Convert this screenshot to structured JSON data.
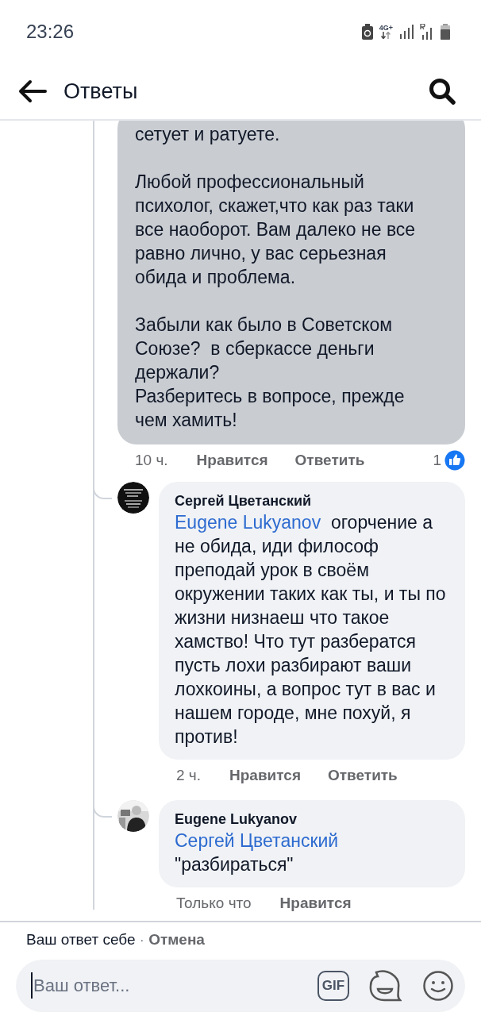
{
  "status_bar": {
    "time": "23:26",
    "network": "4G+"
  },
  "header": {
    "title": "Ответы"
  },
  "comment": {
    "selected": true,
    "paragraphs": [
      [
        "сетует и ратуете."
      ],
      [
        "Любой профессиональный психолог, скажет,что как раз таки все наоборот. Вам далеко не все равно лично, у вас серьезная обида и проблема."
      ],
      [
        "Забыли как было в Советском Союзе?  в сберкассе деньги держали?",
        "Разберитесь в вопросе, прежде чем хамить!"
      ]
    ],
    "time": "10 ч.",
    "actions": [
      "Нравится",
      "Ответить"
    ],
    "like_count": "1"
  },
  "replies": [
    {
      "author": "Сергей Цветанский",
      "mention": "Eugene Lukyanov",
      "text": "огорчение а не обида, иди философ преподай урок в своём окружении таких как ты, и ты по жизни низнаеш что такое хамство! Что тут разбератся пусть лохи разбирают ваши лохкоины, а вопрос тут в вас и нашем городе, мне похуй, я против!",
      "time": "2 ч.",
      "actions": [
        "Нравится",
        "Ответить"
      ]
    },
    {
      "author": "Eugene Lukyanov",
      "mention": "Сергей Цветанский",
      "text": "\"разбираться\"",
      "time": "Только что",
      "actions": [
        "Нравится"
      ]
    }
  ],
  "composer": {
    "context": "Ваш ответ себе",
    "separator": "·",
    "cancel": "Отмена",
    "placeholder": "Ваш ответ...",
    "gif": "GIF"
  }
}
